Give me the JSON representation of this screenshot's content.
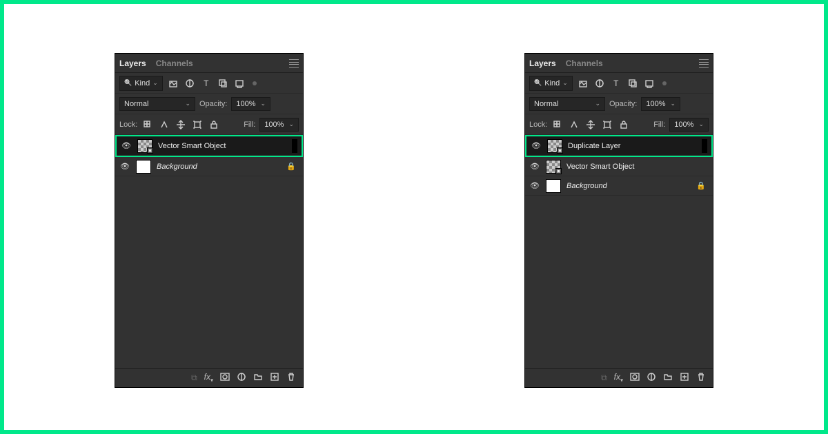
{
  "tabs": {
    "layers": "Layers",
    "channels": "Channels"
  },
  "filter": {
    "kind": "Kind"
  },
  "blend": {
    "mode": "Normal",
    "opacity_lbl": "Opacity:",
    "opacity_val": "100%"
  },
  "lock": {
    "lbl": "Lock:",
    "fill_lbl": "Fill:",
    "fill_val": "100%"
  },
  "left": {
    "layers": [
      {
        "name": "Vector Smart Object",
        "selected": true,
        "highlight": true,
        "smart": true,
        "italic": false,
        "thumb": "checker"
      },
      {
        "name": "Background",
        "selected": false,
        "highlight": false,
        "smart": false,
        "italic": true,
        "thumb": "white",
        "locked": true
      }
    ]
  },
  "right": {
    "layers": [
      {
        "name": "Duplicate Layer",
        "selected": true,
        "highlight": true,
        "smart": true,
        "italic": false,
        "thumb": "checker"
      },
      {
        "name": "Vector Smart Object",
        "selected": false,
        "highlight": false,
        "smart": true,
        "italic": false,
        "thumb": "checker"
      },
      {
        "name": "Background",
        "selected": false,
        "highlight": false,
        "smart": false,
        "italic": true,
        "thumb": "white",
        "locked": true
      }
    ]
  }
}
